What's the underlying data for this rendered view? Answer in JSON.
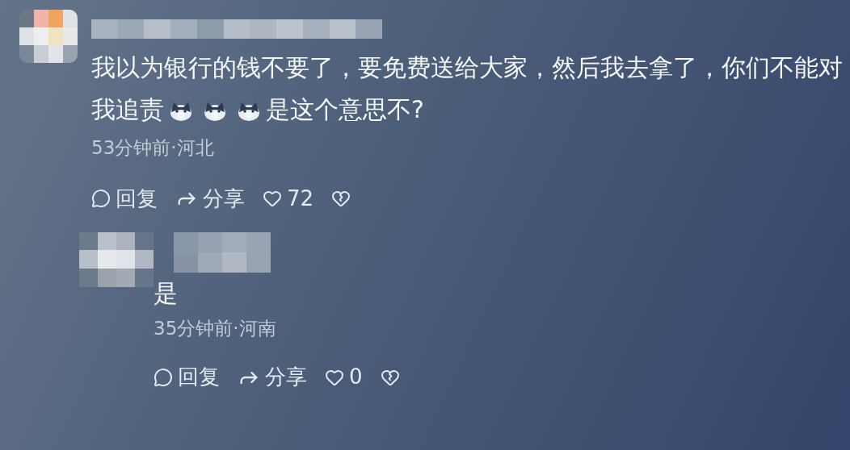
{
  "comments": [
    {
      "content": [
        {
          "kind": "text",
          "text": "我以为银行的钱不要了，要免费送给大家，然后我去拿了，你们不能对我追责"
        },
        {
          "kind": "emoji"
        },
        {
          "kind": "emoji"
        },
        {
          "kind": "emoji"
        },
        {
          "kind": "text",
          "text": "是这个意思不?"
        }
      ],
      "meta": "53分钟前·河北",
      "reply_label": "回复",
      "share_label": "分享",
      "likes": "72"
    },
    {
      "content": [
        {
          "kind": "text",
          "text": "是"
        }
      ],
      "meta": "35分钟前·河南",
      "reply_label": "回复",
      "share_label": "分享",
      "likes": "0"
    }
  ]
}
